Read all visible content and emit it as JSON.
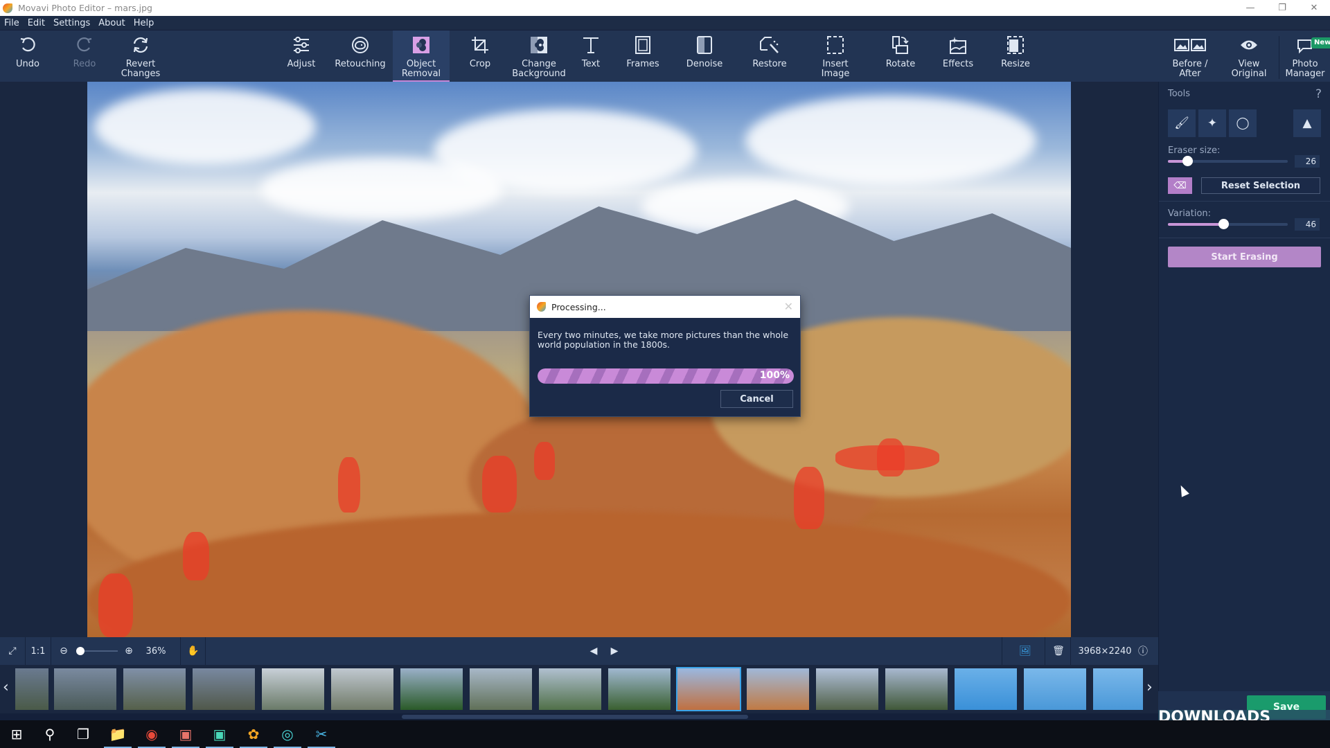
{
  "window": {
    "title": "Movavi Photo Editor – mars.jpg",
    "controls": [
      "minimize",
      "restore",
      "close"
    ]
  },
  "menu": [
    "File",
    "Edit",
    "Settings",
    "About",
    "Help"
  ],
  "toolbar": {
    "left": [
      {
        "label": "Undo",
        "icon": "undo-icon",
        "enabled": true
      },
      {
        "label": "Redo",
        "icon": "redo-icon",
        "enabled": false
      },
      {
        "label": "Revert Changes",
        "icon": "revert-icon",
        "enabled": true
      }
    ],
    "tools": [
      {
        "label": "Adjust",
        "icon": "sliders-icon"
      },
      {
        "label": "Retouching",
        "icon": "face-icon"
      },
      {
        "label": "Object Removal",
        "icon": "object-removal-icon",
        "active": true
      },
      {
        "label": "Crop",
        "icon": "crop-icon"
      },
      {
        "label": "Change Background",
        "icon": "background-icon"
      },
      {
        "label": "Text",
        "icon": "text-icon"
      },
      {
        "label": "Frames",
        "icon": "frame-icon"
      },
      {
        "label": "Denoise",
        "icon": "denoise-icon"
      },
      {
        "label": "Restore",
        "icon": "restore-wand-icon"
      },
      {
        "label": "Insert Image",
        "icon": "insert-image-icon"
      },
      {
        "label": "Rotate",
        "icon": "rotate-icon"
      },
      {
        "label": "Effects",
        "icon": "effects-icon"
      },
      {
        "label": "Resize",
        "icon": "resize-icon"
      }
    ],
    "right": [
      {
        "label": "Before / After",
        "icon": "before-after-icon"
      },
      {
        "label": "View Original",
        "icon": "eye-icon"
      },
      {
        "label": "Photo Manager",
        "icon": "chat-icon",
        "badge": "New"
      }
    ]
  },
  "dialog": {
    "title": "Processing...",
    "message": "Every two minutes, we take more pictures than the whole world population in the 1800s.",
    "progress_percent": 100,
    "progress_label": "100%",
    "cancel_label": "Cancel"
  },
  "panel": {
    "title": "Tools",
    "help": "?",
    "tools": [
      "brush-icon",
      "magic-wand-icon",
      "lasso-icon",
      "stamp-icon"
    ],
    "eraser_size_label": "Eraser size:",
    "eraser_size_value": "26",
    "eraser_size_fraction": 0.16,
    "reset_label": "Reset Selection",
    "variation_label": "Variation:",
    "variation_value": "46",
    "variation_fraction": 0.46,
    "start_label": "Start Erasing"
  },
  "bottom": {
    "fit_ratio": "1:1",
    "zoom": "36%",
    "dimensions": "3968×2240"
  },
  "save_label": "Save",
  "watermark": "DOWNLOADS ⬇.GURU",
  "accent": {
    "purple": "#b386c7",
    "green": "#1a9b6c",
    "bg": "#223453"
  }
}
